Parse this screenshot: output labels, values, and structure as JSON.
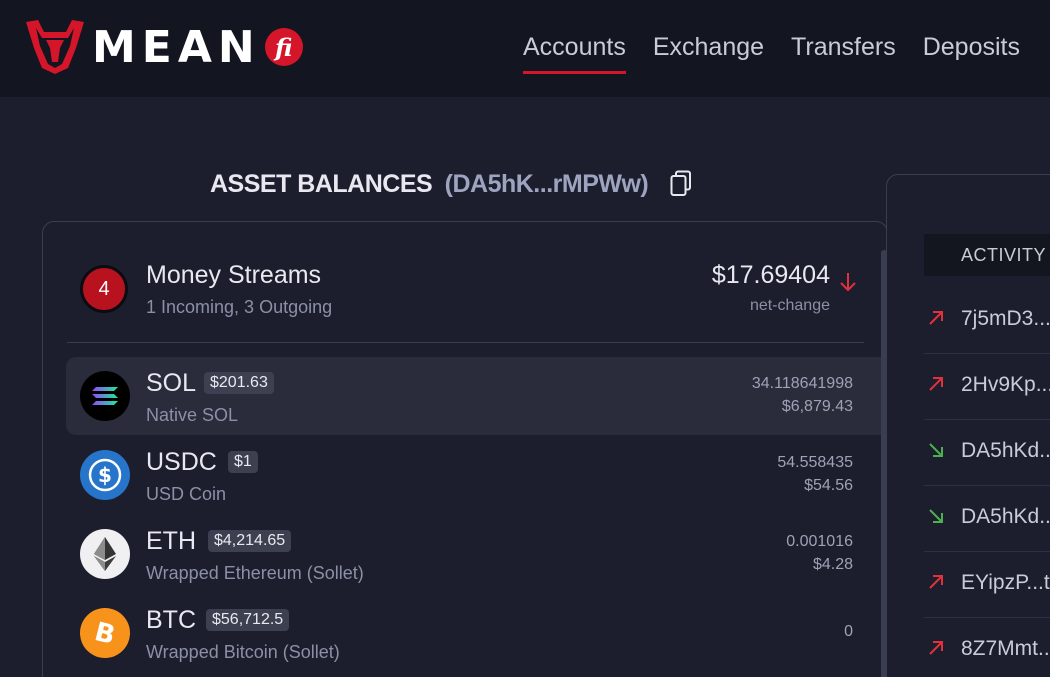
{
  "brand": {
    "name": "MEAN",
    "suffix": "fi",
    "color": "#d5152a"
  },
  "nav": {
    "items": [
      {
        "label": "Accounts",
        "active": true
      },
      {
        "label": "Exchange",
        "active": false
      },
      {
        "label": "Transfers",
        "active": false
      },
      {
        "label": "Deposits",
        "active": false
      }
    ]
  },
  "balances": {
    "title": "ASSET BALANCES",
    "address": "(DA5hK...rMPWw)",
    "copy_icon": "copy-icon"
  },
  "streams": {
    "count": "4",
    "title": "Money Streams",
    "subtitle": "1 Incoming, 3 Outgoing",
    "amount": "$17.69404",
    "amount_label": "net-change",
    "trend_icon": "arrow-down-icon"
  },
  "tokens": [
    {
      "symbol": "SOL",
      "price": "$201.63",
      "name": "Native SOL",
      "amount": "34.118641998",
      "usd": "$6,879.43",
      "selected": true
    },
    {
      "symbol": "USDC",
      "price": "$1",
      "name": "USD Coin",
      "amount": "54.558435",
      "usd": "$54.56",
      "selected": false
    },
    {
      "symbol": "ETH",
      "price": "$4,214.65",
      "name": "Wrapped Ethereum (Sollet)",
      "amount": "0.001016",
      "usd": "$4.28",
      "selected": false
    },
    {
      "symbol": "BTC",
      "price": "$56,712.5",
      "name": "Wrapped Bitcoin (Sollet)",
      "amount": "0",
      "usd": "",
      "selected": false
    }
  ],
  "activity": {
    "header": "ACTIVITY",
    "items": [
      {
        "label": "7j5mD3...",
        "direction": "outgoing",
        "icon": "arrow-up-right-icon"
      },
      {
        "label": "2Hv9Kp...",
        "direction": "outgoing",
        "icon": "arrow-up-right-icon"
      },
      {
        "label": "DA5hKd...",
        "direction": "incoming",
        "icon": "arrow-down-right-icon"
      },
      {
        "label": "DA5hKd...",
        "direction": "incoming",
        "icon": "arrow-down-right-icon"
      },
      {
        "label": "EYipzP...t",
        "direction": "outgoing",
        "icon": "arrow-up-right-icon"
      },
      {
        "label": "8Z7Mmt...",
        "direction": "outgoing",
        "icon": "arrow-up-right-icon"
      }
    ]
  },
  "colors": {
    "outgoing": "#e0313c",
    "incoming": "#4caf50",
    "background": "#1c1e2d"
  }
}
